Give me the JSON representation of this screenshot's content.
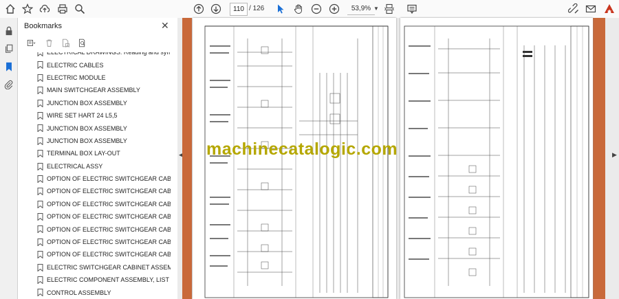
{
  "toolbar": {
    "page_current": "110",
    "page_total": "126",
    "zoom": "53,9%"
  },
  "panel": {
    "title": "Bookmarks",
    "bookmarks": [
      "ELECTRICAL DRAWINGS: Reading and symbols",
      "ELECTRIC CABLES",
      "ELECTRIC MODULE",
      "MAIN SWITCHGEAR ASSEMBLY",
      "JUNCTION BOX ASSEMBLY",
      "WIRE SET HART 24 L5,5",
      "JUNCTION BOX ASSEMBLY",
      "JUNCTION BOX ASSEMBLY",
      "TERMINAL BOX LAY-OUT",
      "ELECTRICAL ASSY",
      "OPTION OF ELECTRIC SWITCHGEAR CABINET",
      "OPTION OF ELECTRIC SWITCHGEAR CABINET",
      "OPTION OF ELECTRIC SWITCHGEAR CABINET",
      "OPTION OF ELECTRIC SWITCHGEAR CABINET",
      "OPTION OF ELECTRIC SWITCHGEAR CABINET",
      "OPTION OF ELECTRIC SWITCHGEAR CABINET",
      "OPTION OF ELECTRIC SWITCHGEAR CABINET",
      "ELECTRIC SWITCHGEAR CABINET ASSEMBLY",
      "ELECTRIC COMPONENT ASSEMBLY, LIST",
      "CONTROL ASSEMBLY"
    ]
  },
  "document": {
    "watermark": "machinecatalogic.com"
  }
}
